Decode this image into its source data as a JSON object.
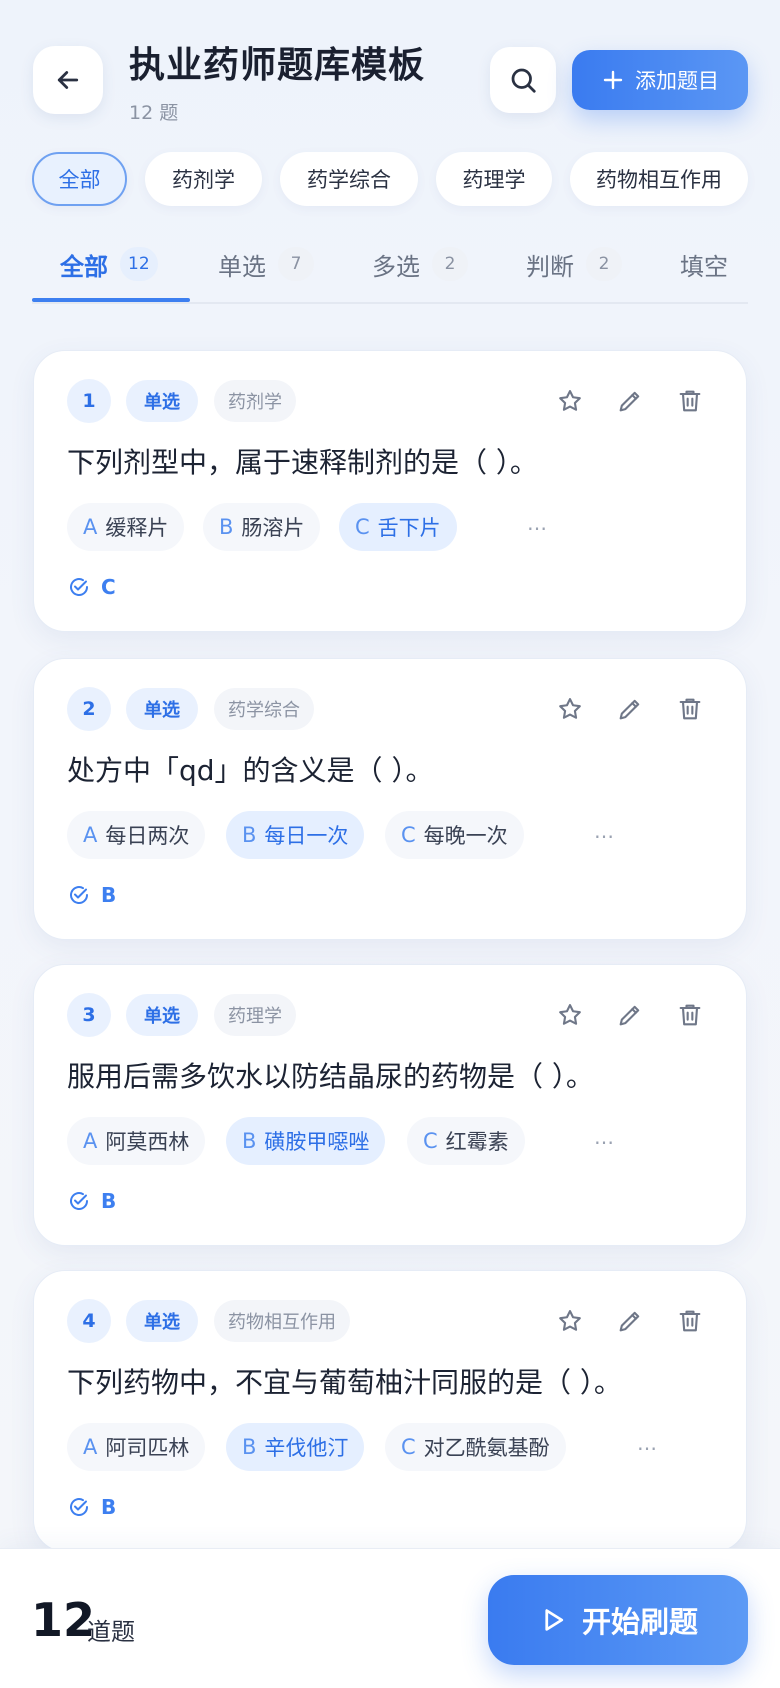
{
  "header": {
    "title": "执业药师题库模板",
    "count_label": "12 题",
    "add_label": "添加题目"
  },
  "categories": [
    "全部",
    "药剂学",
    "药学综合",
    "药理学",
    "药物相互作用"
  ],
  "tabs": [
    {
      "label": "全部",
      "count": "12"
    },
    {
      "label": "单选",
      "count": "7"
    },
    {
      "label": "多选",
      "count": "2"
    },
    {
      "label": "判断",
      "count": "2"
    },
    {
      "label": "填空",
      "count": ""
    }
  ],
  "questions": [
    {
      "num": "1",
      "type": "单选",
      "subject": "药剂学",
      "text": "下列剂型中，属于速释制剂的是（ ）。",
      "options": [
        {
          "letter": "A",
          "text": "缓释片"
        },
        {
          "letter": "B",
          "text": "肠溶片"
        },
        {
          "letter": "C",
          "text": "舌下片"
        }
      ],
      "more": "…",
      "answer": "C"
    },
    {
      "num": "2",
      "type": "单选",
      "subject": "药学综合",
      "text": "处方中「qd」的含义是（ ）。",
      "options": [
        {
          "letter": "A",
          "text": "每日两次"
        },
        {
          "letter": "B",
          "text": "每日一次"
        },
        {
          "letter": "C",
          "text": "每晚一次"
        }
      ],
      "more": "…",
      "answer": "B"
    },
    {
      "num": "3",
      "type": "单选",
      "subject": "药理学",
      "text": "服用后需多饮水以防结晶尿的药物是（ ）。",
      "options": [
        {
          "letter": "A",
          "text": "阿莫西林"
        },
        {
          "letter": "B",
          "text": "磺胺甲噁唑"
        },
        {
          "letter": "C",
          "text": "红霉素"
        }
      ],
      "more": "…",
      "answer": "B"
    },
    {
      "num": "4",
      "type": "单选",
      "subject": "药物相互作用",
      "text": "下列药物中，不宜与葡萄柚汁同服的是（ ）。",
      "options": [
        {
          "letter": "A",
          "text": "阿司匹林"
        },
        {
          "letter": "B",
          "text": "辛伐他汀"
        },
        {
          "letter": "C",
          "text": "对乙酰氨基酚"
        }
      ],
      "more": "…",
      "answer": "B"
    }
  ],
  "footer": {
    "total": "12",
    "total_label": "道题",
    "start_label": "开始刷题"
  },
  "colors": {
    "accent": "#3d7ff0",
    "accent_light": "#e9f1fe"
  }
}
